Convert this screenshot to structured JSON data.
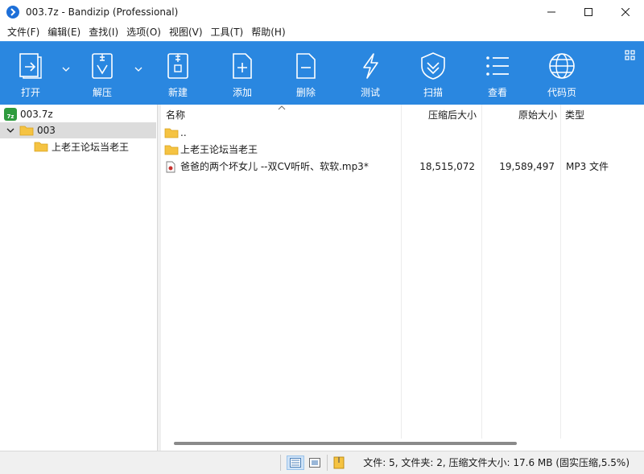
{
  "window": {
    "title": "003.7z - Bandizip (Professional)"
  },
  "menu": [
    "文件(F)",
    "编辑(E)",
    "查找(I)",
    "选项(O)",
    "视图(V)",
    "工具(T)",
    "帮助(H)"
  ],
  "toolbar": {
    "open": "打开",
    "extract": "解压",
    "new": "新建",
    "add": "添加",
    "delete": "删除",
    "test": "测试",
    "scan": "扫描",
    "view": "查看",
    "codepage": "代码页"
  },
  "tree": {
    "archive": "003.7z",
    "folder": "003",
    "subfolder": "上老王论坛当老王"
  },
  "columns": {
    "name": "名称",
    "packed": "压缩后大小",
    "original": "原始大小",
    "type": "类型"
  },
  "files": [
    {
      "name": "..",
      "packed": "",
      "original": "",
      "type": "",
      "icon": "folder-icon"
    },
    {
      "name": "上老王论坛当老王",
      "packed": "",
      "original": "",
      "type": "",
      "icon": "folder-icon"
    },
    {
      "name": "爸爸的两个坏女儿 --双CV听听、软软.mp3*",
      "packed": "18,515,072",
      "original": "19,589,497",
      "type": "MP3 文件",
      "icon": "audio-file-icon"
    }
  ],
  "status": {
    "text": "文件: 5, 文件夹: 2, 压缩文件大小: 17.6 MB (固实压缩,5.5%)"
  },
  "colors": {
    "toolbar": "#2a87e0",
    "folder": "#f5c342",
    "selection": "#dcdcdc"
  }
}
